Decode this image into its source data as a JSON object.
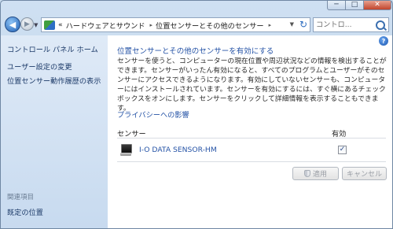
{
  "window": {
    "minimize_glyph": "─",
    "maximize_glyph": "□",
    "close_glyph": "✕"
  },
  "navigation": {
    "back_glyph": "◀",
    "forward_glyph": "▶",
    "history_glyph": "▼"
  },
  "address": {
    "prefix": "«",
    "crumbs": [
      "ハードウェアとサウンド",
      "位置センサーとその他のセンサー"
    ],
    "separator": "▸",
    "dropdown_glyph": "▼",
    "refresh_glyph": "↻"
  },
  "search": {
    "placeholder": "コントロ..."
  },
  "sidebar": {
    "title": "コントロール パネル ホーム",
    "links": [
      "ユーザー設定の変更",
      "位置センサー動作履歴の表示"
    ],
    "related_heading": "関連項目",
    "related_links": [
      "既定の位置"
    ]
  },
  "main": {
    "help_glyph": "?",
    "heading": "位置センサーとその他のセンサーを有効にする",
    "description": "センサーを使うと、コンピューターの現在位置や周辺状況などの情報を検出することができます。センサーがいったん有効になると、すべてのプログラムとユーザーがそのセンサーにアクセスできるようになります。有効にしていないセンサーも、コンピューターにはインストールされています。センサーを有効にするには、すぐ横にあるチェック ボックスをオンにします。センサーをクリックして詳細情報を表示することもできます。",
    "privacy_link": "プライバシーへの影響",
    "columns": {
      "sensor": "センサー",
      "enabled": "有効"
    },
    "sensors": [
      {
        "name": "I-O DATA SENSOR-HM",
        "enabled": true,
        "check_glyph": "✓"
      }
    ],
    "apply_label": "適用",
    "cancel_label": "キャンセル"
  }
}
